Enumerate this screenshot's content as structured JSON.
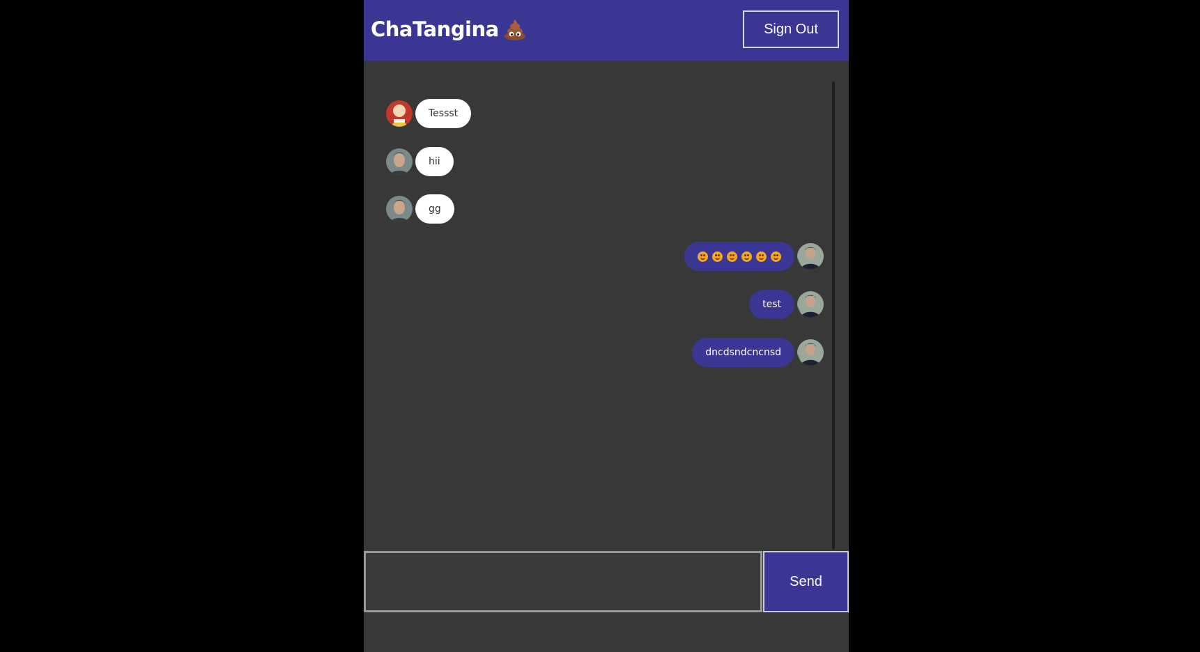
{
  "app": {
    "title": "ChaTangina",
    "logo_icon": "poop-emoji-icon"
  },
  "header": {
    "signout_label": "Sign Out"
  },
  "colors": {
    "brand": "#3a3694",
    "background": "#383838",
    "received_bubble": "#ffffff",
    "page_background": "#000000"
  },
  "messages": [
    {
      "direction": "received",
      "text": "Tessst",
      "avatar": "bald-hero-avatar"
    },
    {
      "direction": "received",
      "text": "hii",
      "avatar": "user-photo-avatar"
    },
    {
      "direction": "received",
      "text": "gg",
      "avatar": "user-photo-avatar"
    },
    {
      "direction": "sent",
      "text": "",
      "emoji_count": 6,
      "avatar": "self-photo-avatar"
    },
    {
      "direction": "sent",
      "text": "test",
      "avatar": "self-photo-avatar"
    },
    {
      "direction": "sent",
      "text": "dncdsndcncnsd",
      "avatar": "self-photo-avatar"
    }
  ],
  "composer": {
    "value": "",
    "placeholder": "",
    "send_label": "Send"
  }
}
